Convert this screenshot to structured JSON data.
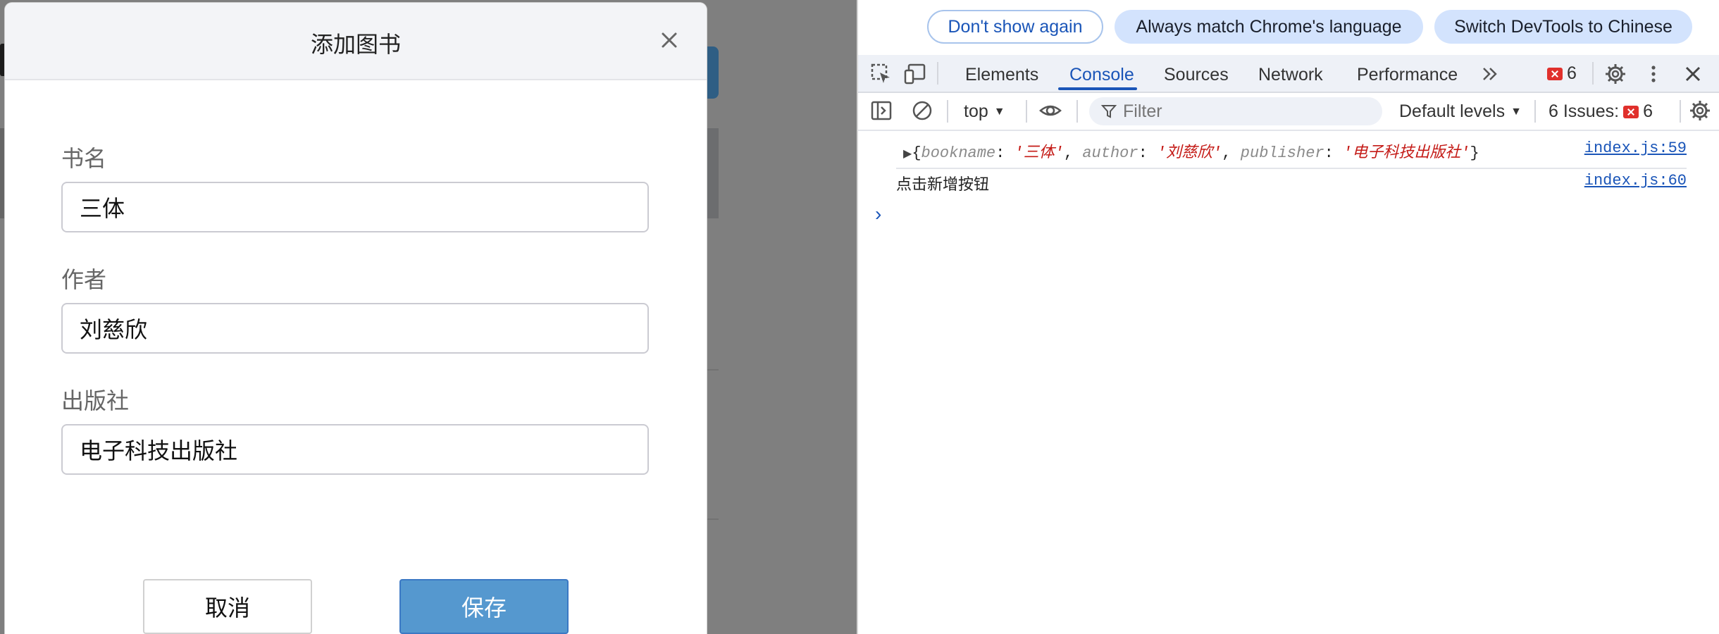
{
  "modal": {
    "title": "添加图书",
    "fields": [
      {
        "label": "书名",
        "value": "三体"
      },
      {
        "label": "作者",
        "value": "刘慈欣"
      },
      {
        "label": "出版社",
        "value": "电子科技出版社"
      }
    ],
    "cancel_label": "取消",
    "save_label": "保存"
  },
  "devtools": {
    "infobar": {
      "dont_show": "Don't show again",
      "match_language": "Always match Chrome's language",
      "switch_chinese": "Switch DevTools to Chinese"
    },
    "tabs": [
      "Elements",
      "Console",
      "Sources",
      "Network",
      "Performance"
    ],
    "active_tab": "Console",
    "error_count": "6",
    "toolbar": {
      "context": "top",
      "filter_placeholder": "Filter",
      "levels": "Default levels",
      "issues_label": "6 Issues:",
      "issues_count": "6"
    },
    "console": {
      "entries": [
        {
          "object": {
            "k1": "bookname",
            "v1": "'三体'",
            "k2": "author",
            "v2": "'刘慈欣'",
            "k3": "publisher",
            "v3": "'电子科技出版社'"
          },
          "source": "index.js:59"
        },
        {
          "text": "点击新增按钮",
          "source": "index.js:60"
        }
      ]
    }
  },
  "colors": {
    "accent": "#1a55b8",
    "save_button": "#5598cf",
    "error_badge": "#e0302c",
    "overlay": "#7f7f7f"
  }
}
